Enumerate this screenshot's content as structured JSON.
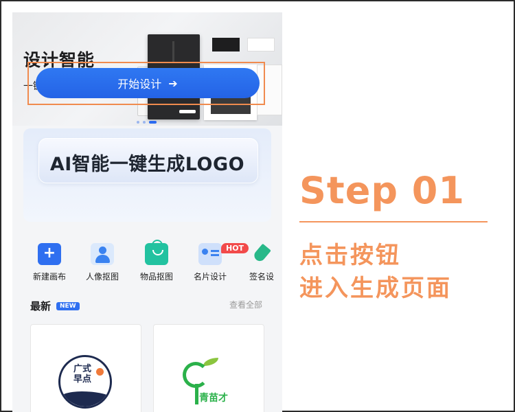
{
  "banner": {
    "title": "设计智能",
    "subtitle": "一键生成"
  },
  "ai_card": {
    "title": "AI智能一键生成LOGO",
    "button_label": "开始设计",
    "button_arrow": "➔"
  },
  "tools": {
    "hot_badge": "HOT",
    "items": [
      {
        "label": "新建画布",
        "icon": "plus-icon"
      },
      {
        "label": "人像抠图",
        "icon": "portrait-icon"
      },
      {
        "label": "物品抠图",
        "icon": "shopping-bag-icon"
      },
      {
        "label": "名片设计",
        "icon": "business-card-icon"
      },
      {
        "label": "签名设",
        "icon": "pen-icon"
      }
    ]
  },
  "latest": {
    "title": "最新",
    "badge": "NEW",
    "view_all": "查看全部",
    "tiles": [
      {
        "logo_text": "广式\n早点"
      },
      {
        "logo_text": "青苗才"
      }
    ]
  },
  "step": {
    "title": "Step 01",
    "line1": "点击按钮",
    "line2": "进入生成页面"
  },
  "colors": {
    "accent_blue": "#2f6ff0",
    "step_orange": "#f4955c",
    "highlight_border": "#f08b4e",
    "hot_red": "#f24a4a"
  }
}
